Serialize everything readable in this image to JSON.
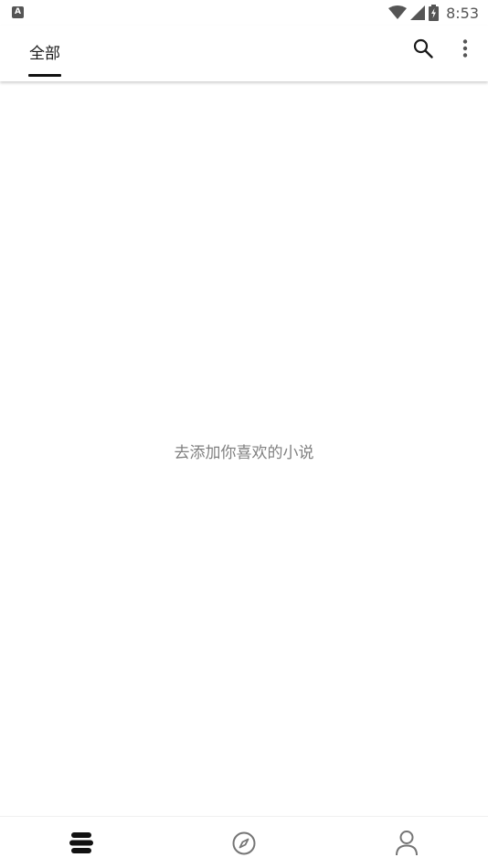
{
  "status_bar": {
    "notification_icon": "A",
    "time": "8:53",
    "icons": [
      "wifi-icon",
      "signal-icon",
      "battery-charging-icon"
    ]
  },
  "top_bar": {
    "tabs": [
      {
        "label": "全部",
        "selected": true
      }
    ],
    "actions": [
      "search-icon",
      "more-vertical-icon"
    ]
  },
  "main": {
    "empty_message": "去添加你喜欢的小说"
  },
  "bottom_nav": {
    "items": [
      {
        "icon": "bookshelf-icon",
        "selected": true
      },
      {
        "icon": "compass-icon",
        "selected": false
      },
      {
        "icon": "person-icon",
        "selected": false
      }
    ]
  },
  "colors": {
    "background": "#ffffff",
    "empty_text": "#808080",
    "tab_indicator": "#111111",
    "icon_inactive": "#757575",
    "icon_active": "#111111"
  }
}
